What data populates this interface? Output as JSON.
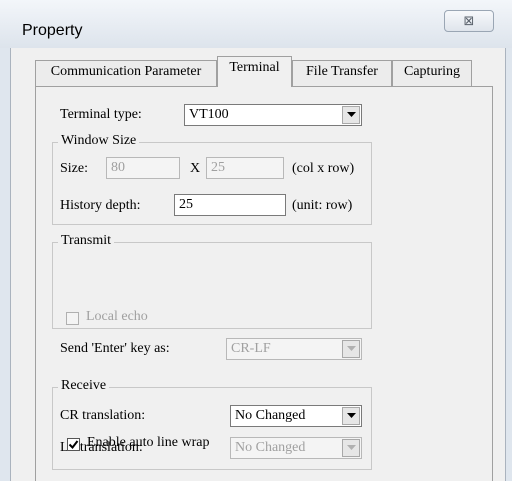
{
  "window": {
    "title": "Property",
    "close_glyph": "⊠"
  },
  "tabs": [
    {
      "label": "Communication Parameter",
      "active": false
    },
    {
      "label": "Terminal",
      "active": true
    },
    {
      "label": "File Transfer",
      "active": false
    },
    {
      "label": "Capturing",
      "active": false
    }
  ],
  "terminal": {
    "type_label": "Terminal type:",
    "type_value": "VT100"
  },
  "window_size": {
    "title": "Window Size",
    "size_label": "Size:",
    "cols": "80",
    "x_label": "X",
    "rows": "25",
    "size_unit": "(col x row)",
    "history_label": "History depth:",
    "history_value": "25",
    "history_unit": "(unit: row)"
  },
  "transmit": {
    "title": "Transmit",
    "local_echo_label": "Local echo",
    "local_echo_checked": false,
    "send_enter_label": "Send 'Enter' key as:",
    "send_enter_value": "CR-LF"
  },
  "receive": {
    "title": "Receive",
    "cr_label": "CR translation:",
    "cr_value": "No Changed",
    "lf_label": "LF translation:",
    "lf_value": "No Changed"
  },
  "options": {
    "auto_wrap_label": "Enable auto line wrap",
    "auto_wrap_checked": true
  },
  "colors": {
    "title_bar": "#dfe6ee",
    "dialog_bg": "#f0f0f0",
    "disabled_text": "#a0a0a0"
  }
}
